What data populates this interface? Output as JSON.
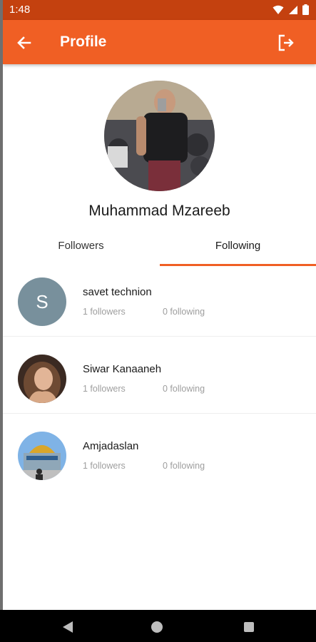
{
  "status_bar": {
    "time": "1:48"
  },
  "app_bar": {
    "title": "Profile",
    "back_icon": "arrow-left-icon",
    "logout_icon": "logout-icon"
  },
  "colors": {
    "accent": "#f05f24",
    "status_bar": "#c4410f",
    "initial_avatar_bg": "#78909c"
  },
  "profile": {
    "name": "Muhammad Mzareeb"
  },
  "tabs": [
    {
      "label": "Followers",
      "selected": false
    },
    {
      "label": "Following",
      "selected": true
    }
  ],
  "users": [
    {
      "name": "savet technion",
      "initial": "S",
      "followers": "1 followers",
      "following": "0 following"
    },
    {
      "name": "Siwar Kanaaneh",
      "followers": "1 followers",
      "following": "0 following"
    },
    {
      "name": "Amjadaslan",
      "followers": "1 followers",
      "following": "0 following"
    }
  ]
}
